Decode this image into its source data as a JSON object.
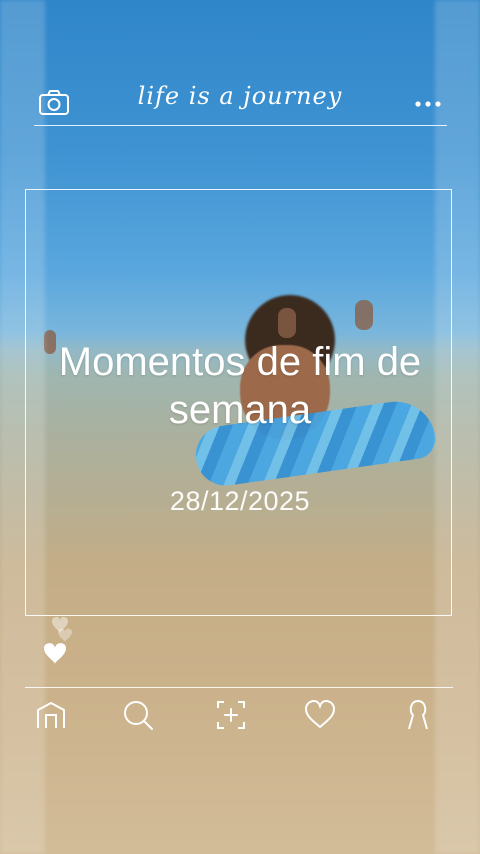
{
  "header": {
    "title": "life is a journey",
    "camera_icon": "camera-icon",
    "more_icon": "more-options-icon"
  },
  "post": {
    "title": "Momentos de fim de semana",
    "date": "28/12/2025",
    "like_icon": "heart-icon"
  },
  "nav": {
    "items": [
      {
        "icon": "home-icon"
      },
      {
        "icon": "search-icon"
      },
      {
        "icon": "add-photo-icon"
      },
      {
        "icon": "heart-icon"
      },
      {
        "icon": "profile-icon"
      }
    ]
  },
  "colors": {
    "overlay": "#ffffff",
    "sky": "#3f93d2",
    "sand": "#c9b089"
  }
}
